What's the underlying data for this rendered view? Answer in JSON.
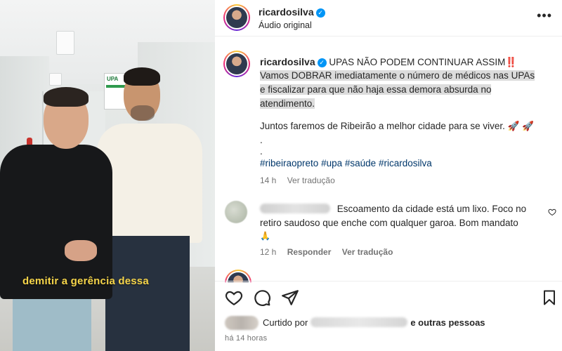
{
  "video": {
    "caption": "demitir a gerência dessa",
    "sign_text": "UPA"
  },
  "header": {
    "username": "ricardosilva",
    "subtitle": "Áudio original",
    "more_icon": "more-horizontal-icon"
  },
  "post": {
    "username": "ricardosilva",
    "headline": "UPAS NÃO PODEM CONTINUAR ASSIM",
    "headline_emoji": "‼️",
    "lines": [
      "Vamos DOBRAR imediatamente o número de médicos nas UPAs",
      "e fiscalizar para que não haja essa demora absurda no",
      "atendimento."
    ],
    "line2": "Juntos faremos de Ribeirão a melhor cidade para se viver.",
    "line2_emoji": "🚀 🚀",
    "dot1": ".",
    "dot2": ".",
    "hashtags": [
      "#ribeiraopreto",
      "#upa",
      "#saúde",
      "#ricardosilva"
    ],
    "time": "14 h",
    "see_translation": "Ver tradução"
  },
  "comment": {
    "text_line1": "Escoamento da cidade está um lixo. Foco no",
    "text_line2": "retiro saudoso que enche com qualquer garoa. Bom mandato",
    "emoji": "🙏",
    "time": "12 h",
    "reply": "Responder",
    "see_translation": "Ver tradução"
  },
  "likes": {
    "prefix": "Curtido por",
    "suffix": "e outras pessoas"
  },
  "timestamp": "há 14 horas",
  "colors": {
    "verified": "#0095f6",
    "hashtag": "#00376b",
    "caption_yellow": "#f6d54a",
    "highlight": "#dcdcdc"
  }
}
